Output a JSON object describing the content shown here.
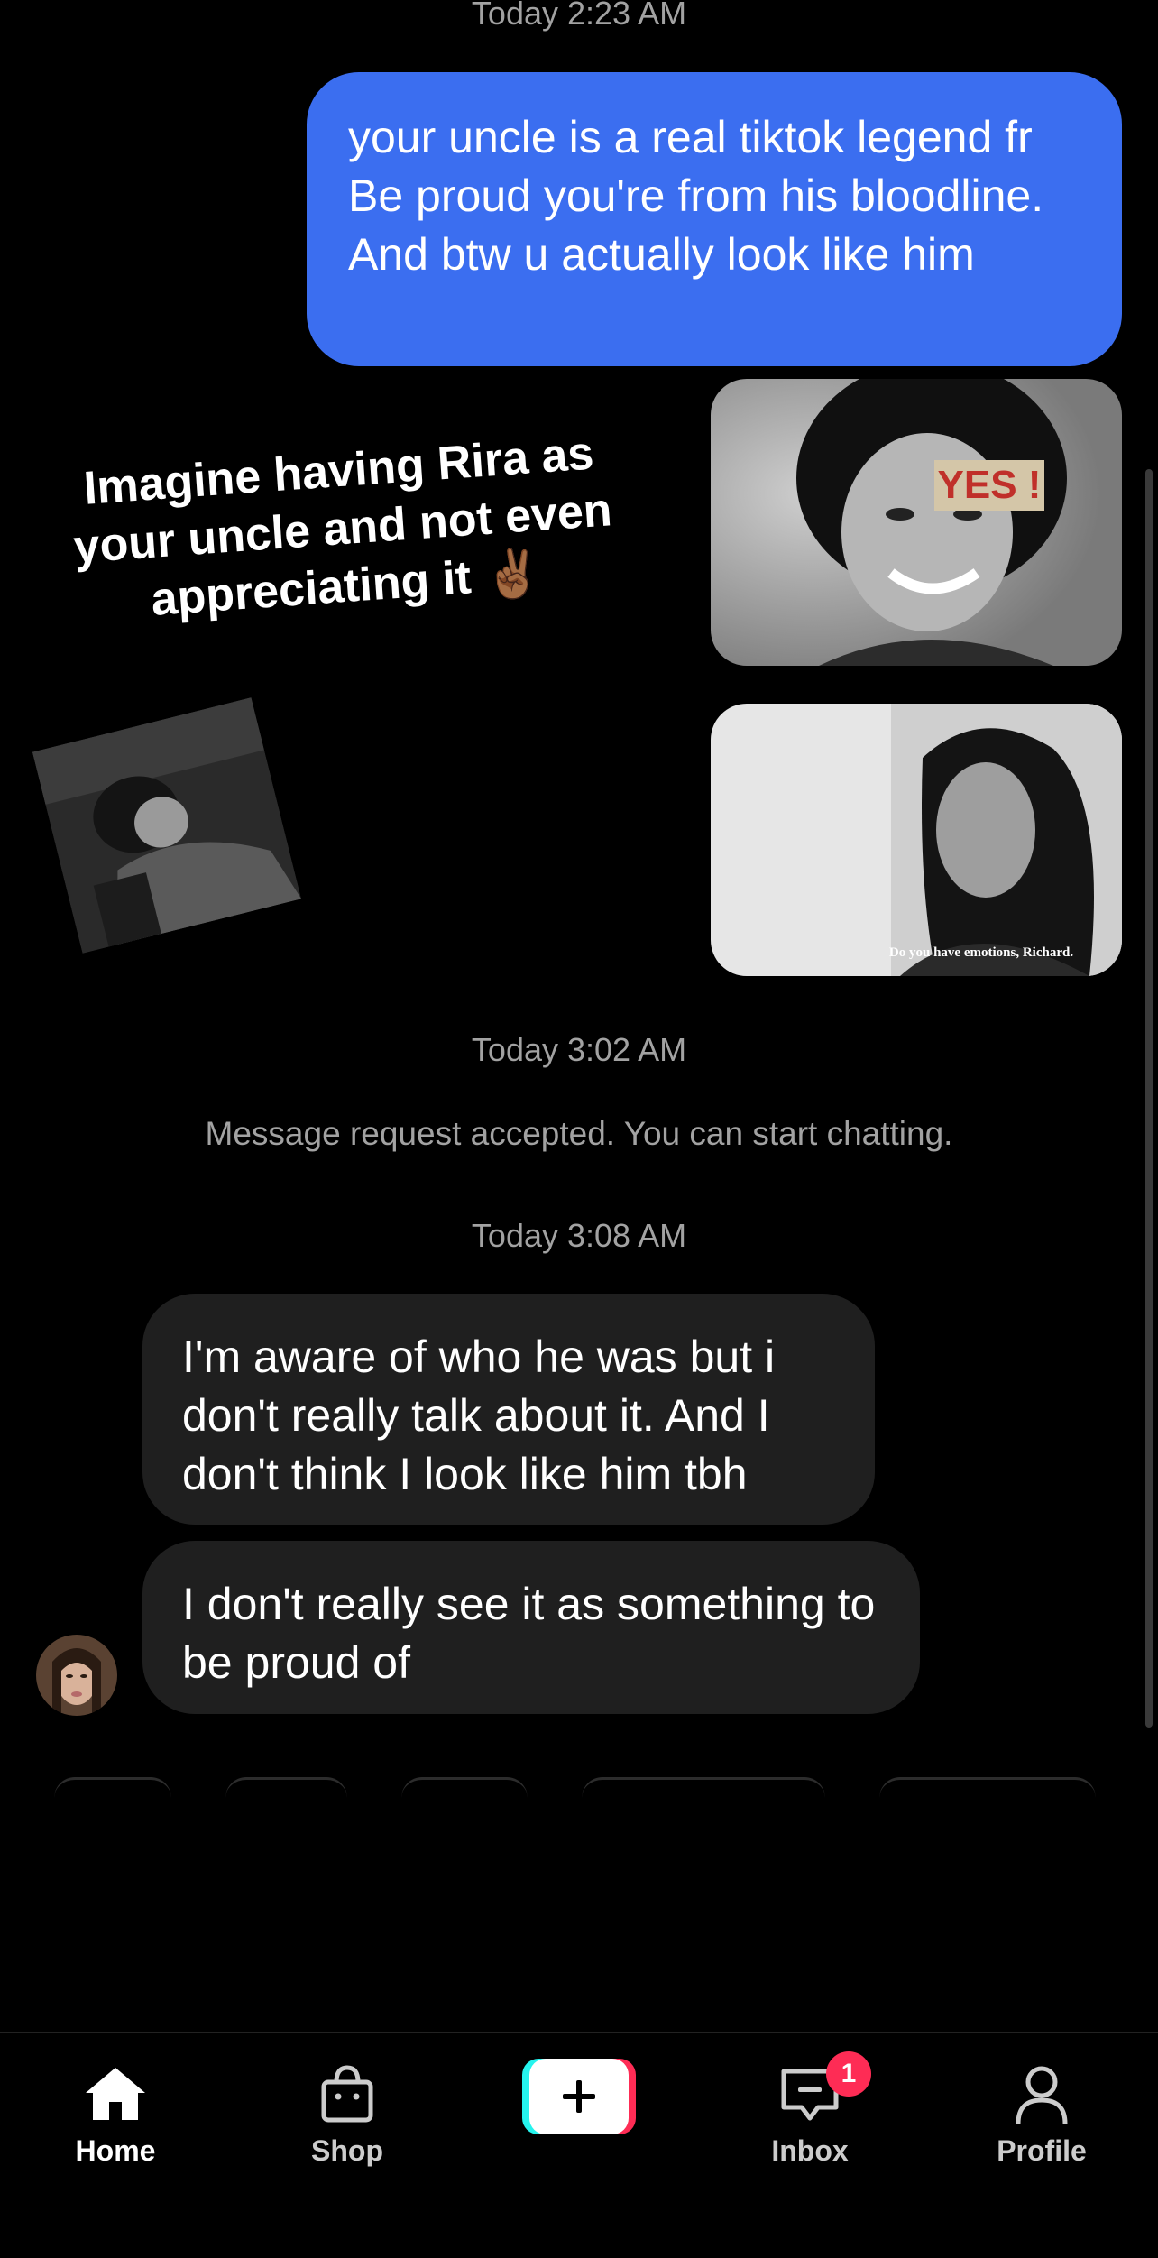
{
  "conversation": {
    "timestamp_1": "Today 2:23 AM",
    "outgoing_message": "your uncle is a real tiktok legend fr Be proud you're from his bloodline. And btw u actually look like him",
    "shared_media": {
      "caption": "Imagine having Rira as your uncle and not even appreciating it ✌🏾",
      "image_text_1": "YES !",
      "image_text_2": "Do you have emotions, Richard."
    },
    "timestamp_2": "Today 3:02 AM",
    "system_message": "Message request accepted. You can start chatting.",
    "timestamp_3": "Today 3:08 AM",
    "incoming_messages": [
      {
        "text": "I'm aware of who he was but i don't really talk about it. And I don't think I look like him tbh"
      },
      {
        "text": "I don't really see it as something to be proud of"
      }
    ]
  },
  "bottom_nav": {
    "items": [
      {
        "label": "Home",
        "icon": "home-icon",
        "active": true
      },
      {
        "label": "Shop",
        "icon": "shopping-bag-icon",
        "active": false
      },
      {
        "label": "",
        "icon": "plus-icon",
        "active": false
      },
      {
        "label": "Inbox",
        "icon": "inbox-icon",
        "active": false,
        "badge": "1"
      },
      {
        "label": "Profile",
        "icon": "profile-icon",
        "active": false
      }
    ]
  },
  "colors": {
    "background": "#000000",
    "outgoing_bubble": "#3b6ef0",
    "incoming_bubble": "#1f1f1f",
    "badge": "#fe2c55",
    "timestamp": "#a2a2a2"
  }
}
